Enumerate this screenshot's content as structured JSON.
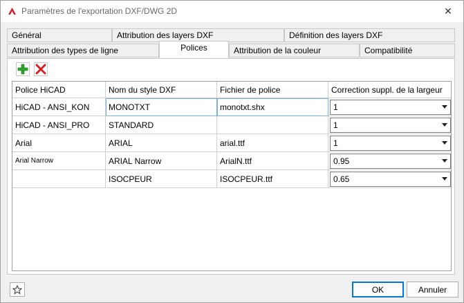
{
  "window": {
    "title": "Paramètres de l'exportation DXF/DWG 2D",
    "close_glyph": "✕"
  },
  "tabs": {
    "row1": [
      {
        "label": "Général"
      },
      {
        "label": "Attribution des layers DXF"
      },
      {
        "label": "Définition des layers DXF"
      }
    ],
    "row2": [
      {
        "label": "Attribution des types de ligne"
      },
      {
        "label": "Polices",
        "active": true
      },
      {
        "label": "Attribution de la couleur"
      },
      {
        "label": "Compatibilité"
      }
    ]
  },
  "toolbar": {
    "add_icon": "plus-icon",
    "delete_icon": "delete-x-icon",
    "add_color": "#2fa52f",
    "delete_color": "#d62020"
  },
  "table": {
    "columns": [
      "Police HiCAD",
      "Nom du style DXF",
      "Fichier de police",
      "Correction suppl. de la largeur"
    ],
    "rows": [
      {
        "font": "HiCAD - ANSI_KON",
        "style": "MONOTXT",
        "file": "monotxt.shx",
        "correction": "1"
      },
      {
        "font": "HiCAD - ANSI_PRO",
        "style": "STANDARD",
        "file": "",
        "correction": "1"
      },
      {
        "font": "Arial",
        "style": "ARIAL",
        "file": "arial.ttf",
        "correction": "1"
      },
      {
        "font": "Arial Narrow",
        "style": "ARIAL Narrow",
        "file": "ArialN.ttf",
        "correction": "0.95"
      },
      {
        "font": "",
        "style": "ISOCPEUR",
        "file": "ISOCPEUR.ttf",
        "correction": "0.65"
      }
    ]
  },
  "footer": {
    "favorite_icon": "star-icon",
    "ok_label": "OK",
    "cancel_label": "Annuler"
  }
}
